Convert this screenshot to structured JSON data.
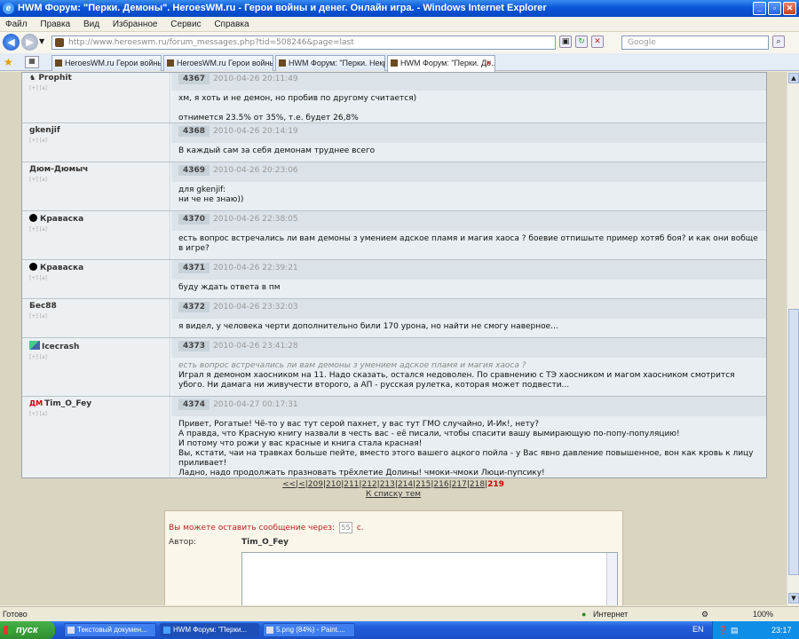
{
  "window": {
    "title": "HWM Форум: \"Перки. Демоны\". HeroesWM.ru - Герои войны и денег. Онлайн игра. - Windows Internet Explorer"
  },
  "menu": [
    "Файл",
    "Правка",
    "Вид",
    "Избранное",
    "Сервис",
    "Справка"
  ],
  "address": {
    "url": "http://www.heroeswm.ru/forum_messages.php?tid=508246&page=last",
    "search_placeholder": "Google"
  },
  "tabs": [
    {
      "label": "HeroesWM.ru Герои войны ..."
    },
    {
      "label": "HeroesWM.ru Герои войны ..."
    },
    {
      "label": "HWM Форум: \"Перки. Некро...\""
    },
    {
      "label": "HWM Форум: \"Перки. Де...\"",
      "active": true
    }
  ],
  "posts": [
    {
      "author": "Prophit",
      "icon": "none",
      "num": "4367",
      "date": "2010-04-26 20:11:49",
      "quote": "",
      "body": "хм, я хоть и не демон, но пробив по другому считается)\n\nотнимется 23.5% от 35%, т.е. будет 26,8%"
    },
    {
      "author": "gkenjif",
      "icon": "none",
      "num": "4368",
      "date": "2010-04-26 20:14:19",
      "quote": "",
      "body": "В каждый сам за себя демонам труднее всего"
    },
    {
      "author": "Дюм-Дюмыч",
      "icon": "none",
      "num": "4369",
      "date": "2010-04-26 20:23:06",
      "quote": "",
      "body": "для gkenjif:\nни че не знаю))"
    },
    {
      "author": "Краваска",
      "icon": "dot",
      "num": "4370",
      "date": "2010-04-26 22:38:05",
      "quote": "",
      "body": "есть вопрос встречались ли вам демоны з умением адское пламя и магия хаоса ? боевие отпишыте пример хотяб боя? и как они вобще в игре?"
    },
    {
      "author": "Краваска",
      "icon": "dot",
      "num": "4371",
      "date": "2010-04-26 22:39:21",
      "quote": "",
      "body": "буду ждать ответа в пм"
    },
    {
      "author": "Бес88",
      "icon": "none",
      "num": "4372",
      "date": "2010-04-26 23:32:03",
      "quote": "",
      "body": "я видел, у человека черти дополнительно били 170 урона, но найти не смогу наверное..."
    },
    {
      "author": "Icecrash",
      "icon": "clan",
      "num": "4373",
      "date": "2010-04-26 23:41:28",
      "quote": "есть вопрос встречались ли вам демоны з умением адское пламя и магия хаоса ?",
      "body": "Играл я демоном хаосником на 11. Надо сказать, остался недоволен. По сравнению с ТЭ хаосником и магом хаосником смотрится убого. Ни дамага ни живучести второго, а АП - русская рулетка, которая может подвести..."
    },
    {
      "author": "Tim_O_Fey",
      "icon": "dm",
      "num": "4374",
      "date": "2010-04-27 00:17:31",
      "quote": "",
      "body": "Привет, Рогатые! Чё-то у вас тут серой пахнет, у вас тут ГМО случайно, И-Ик!, нету?\nА правда, что Красную книгу назвали в честь вас - её писали, чтобы спасити вашу вымирающую по-попу-популяцию!\nИ потому что рожи у вас красные и книга стала красная!\nВы, кстати, чаи на травках больше пейте, вместо этого вашего ацкого пойла - у Вас явно давление повышенное, вон как кровь к лицу приливает!\nЛадно, надо продолжать празновать трёхлетие Долины! чмоки-чмоки Люци-пупсику!"
    }
  ],
  "post_mini": "[+] [a]",
  "clan_tag": "ДМ",
  "pager": {
    "prefix": "<<|<|",
    "pages": [
      "209",
      "210",
      "211",
      "212",
      "213",
      "214",
      "215",
      "216",
      "217",
      "218"
    ],
    "current": "219",
    "to_list": "К списку тем"
  },
  "reply": {
    "note_before": "Вы можете оставить сообщение через:",
    "seconds": "55",
    "note_after": "с.",
    "author_label": "Автор:",
    "author_value": "Tim_O_Fey"
  },
  "status": {
    "left": "Готово",
    "zone": "Интернет",
    "zoom": "100%"
  },
  "taskbar": {
    "start": "пуск",
    "items": [
      "Текстовый докумен...",
      "HWM Форум: \"Перки...",
      "5.png (84%) - Paint...."
    ],
    "lang": "EN",
    "clock": "23:17"
  }
}
